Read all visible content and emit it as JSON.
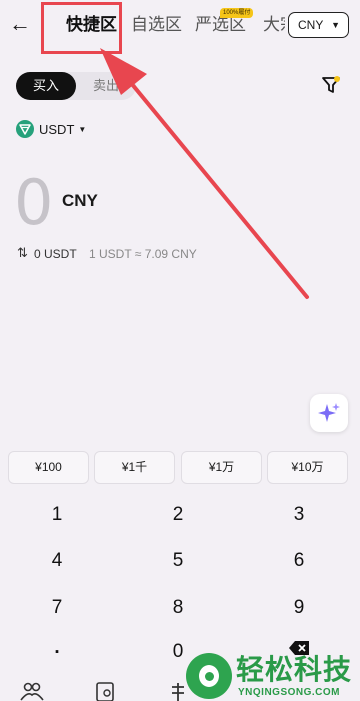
{
  "header": {
    "back_icon": "arrow-left-icon",
    "tabs": [
      {
        "label": "快捷区",
        "active": true
      },
      {
        "label": "自选区",
        "active": false
      },
      {
        "label": "严选区",
        "active": false,
        "badge": "100%履付"
      },
      {
        "label": "大宗区",
        "active": false
      }
    ],
    "currency": "CNY"
  },
  "trade": {
    "buy_label": "买入",
    "sell_label": "卖出",
    "selected": "buy",
    "filter_icon": "filter-icon"
  },
  "asset": {
    "symbol": "USDT",
    "icon": "tether-icon"
  },
  "amount": {
    "value": "0",
    "currency": "CNY",
    "converted": "0 USDT",
    "rate": "1 USDT ≈ 7.09 CNY"
  },
  "ai_icon": "sparkle-icon",
  "quick_amounts": [
    "¥100",
    "¥1千",
    "¥1万",
    "¥10万"
  ],
  "keypad": [
    "1",
    "2",
    "3",
    "4",
    "5",
    "6",
    "7",
    "8",
    "9",
    ".",
    "0",
    "backspace"
  ],
  "bottom_nav": [
    "users-icon",
    "document-icon",
    "currency-icon"
  ],
  "watermark": {
    "title": "轻松科技",
    "subtitle": "YNQINGSONG.COM"
  },
  "colors": {
    "background": "#f3f0f5",
    "accent": "#111111",
    "annotation": "#e8464f",
    "tether": "#26a17b",
    "watermark": "#2a9a48"
  }
}
